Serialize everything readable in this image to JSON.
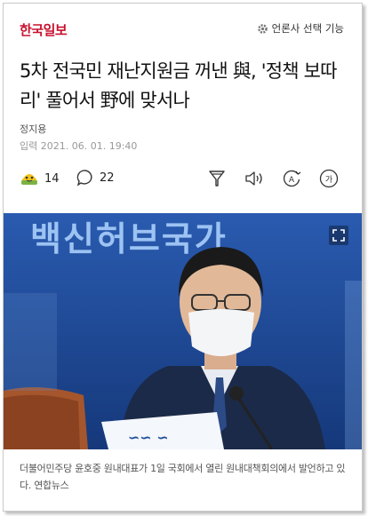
{
  "header": {
    "logo": "한국일보",
    "settings_label": "언론사 선택 기능",
    "settings_icon": "gear-icon"
  },
  "article": {
    "title": "5차 전국민 재난지원금 꺼낸 與, '정책 보따리' 풀어서 野에 맞서나",
    "author": "정지용",
    "date": "입력 2021. 06. 01. 19:40"
  },
  "toolbar": {
    "reaction_icon": "reaction-emoji-icon",
    "reaction_count": "14",
    "comment_icon": "comment-icon",
    "comment_count": "22",
    "actions": [
      "summary-icon",
      "listen-icon",
      "translate-icon",
      "font-size-icon"
    ],
    "translate_glyph": "A",
    "font_glyph": "가"
  },
  "photo": {
    "backdrop_text": "백신허브국가",
    "expand_icon": "expand-icon",
    "paper_text": "∽∽ ∽"
  },
  "caption": "더불어민주당 윤호중 원내대표가 1일 국회에서 열린 원내대책회의에서 발언하고 있다. 연합뉴스",
  "colors": {
    "brand": "#c8102e",
    "photo_bg": "#1f4c9b",
    "text": "#111111",
    "muted": "#999999"
  }
}
